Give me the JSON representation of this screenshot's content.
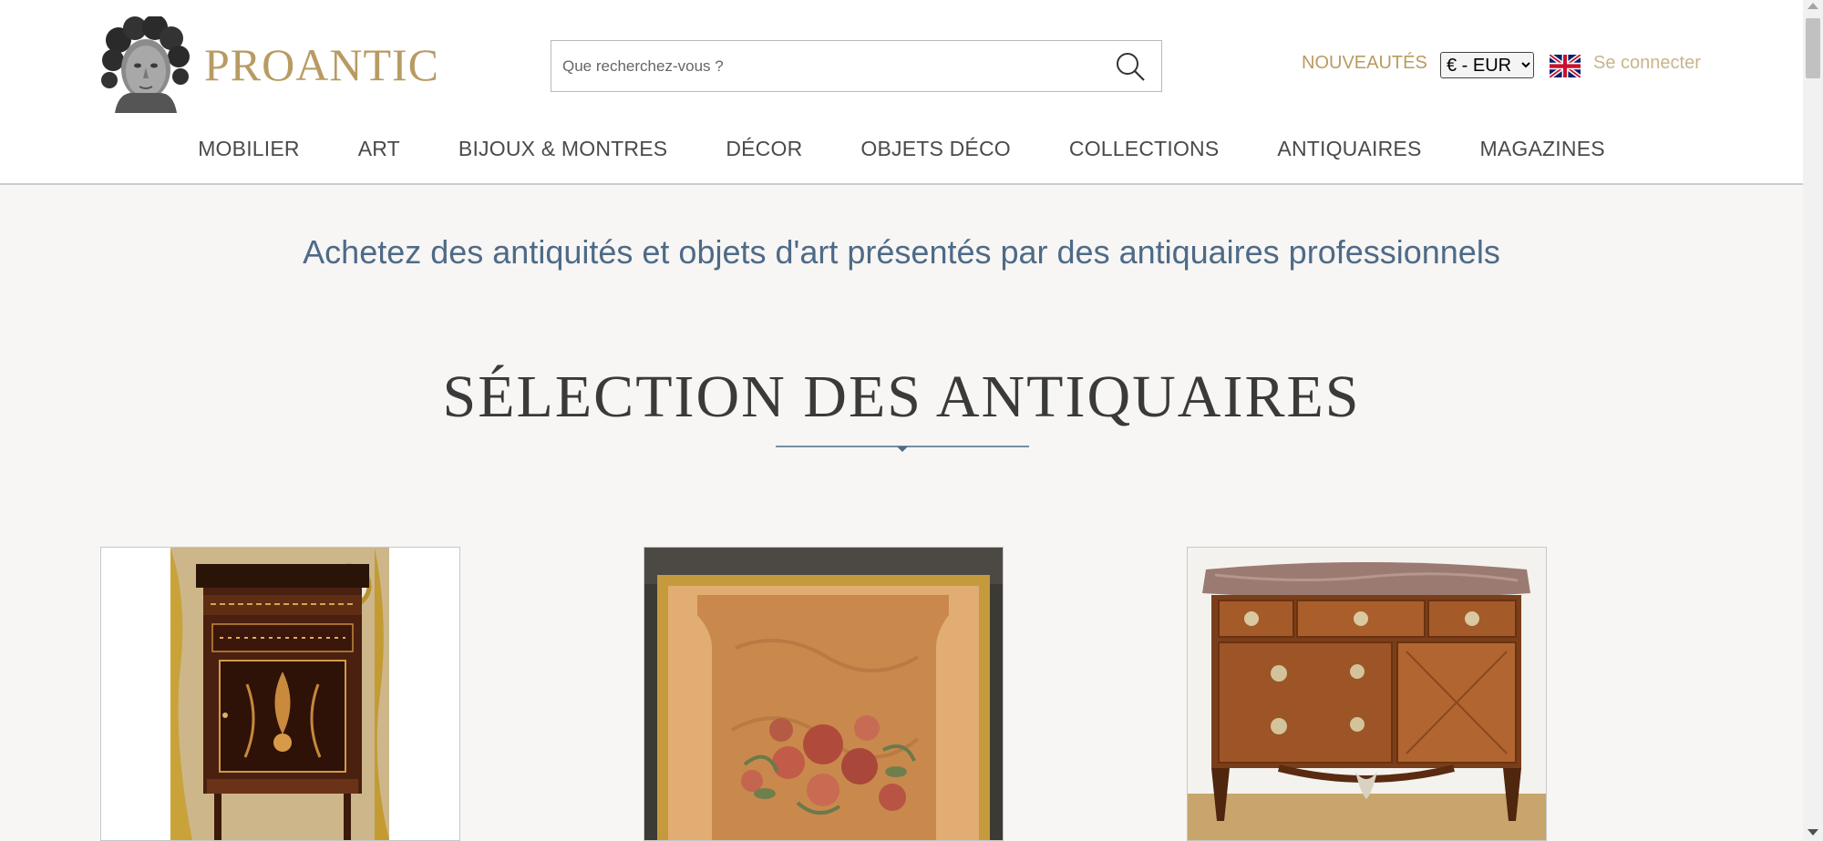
{
  "header": {
    "logo_text": "PROANTIC",
    "search_placeholder": "Que recherchez-vous ?",
    "nouveautes_label": "NOUVEAUTÉS",
    "currency_selected": "€ - EUR",
    "login_label": "Se connecter",
    "language_flag": "uk-flag-icon"
  },
  "nav": {
    "items": [
      "MOBILIER",
      "ART",
      "BIJOUX & MONTRES",
      "DÉCOR",
      "OBJETS DÉCO",
      "COLLECTIONS",
      "ANTIQUAIRES",
      "MAGAZINES"
    ]
  },
  "main": {
    "tagline": "Achetez des antiquités et objets d'art présentés par des antiquaires professionnels",
    "section_title": "SÉLECTION DES ANTIQUAIRES"
  },
  "colors": {
    "brand_gold": "#b89b63",
    "tagline_blue": "#4e6a87",
    "page_bg": "#f7f6f4"
  }
}
